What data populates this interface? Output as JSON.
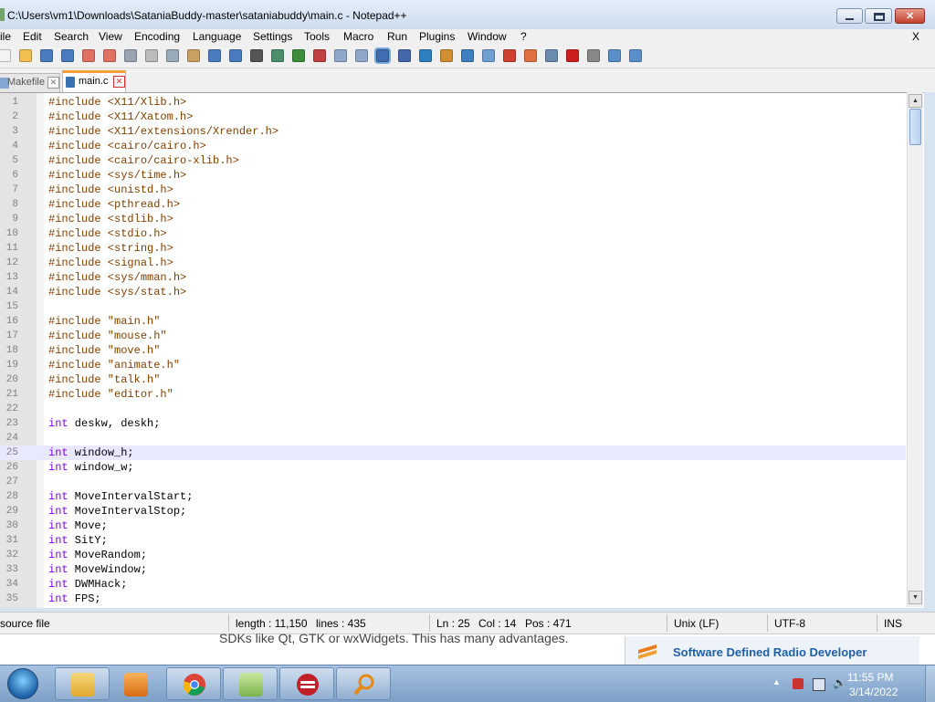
{
  "window": {
    "title": "C:\\Users\\vm1\\Downloads\\SataniaBuddy-master\\sataniabuddy\\main.c - Notepad++"
  },
  "menu": [
    {
      "label": "ile"
    },
    {
      "label": "Edit"
    },
    {
      "label": "Search"
    },
    {
      "label": "View"
    },
    {
      "label": "Encoding"
    },
    {
      "label": "Language"
    },
    {
      "label": "Settings"
    },
    {
      "label": "Tools"
    },
    {
      "label": "Macro"
    },
    {
      "label": "Run"
    },
    {
      "label": "Plugins"
    },
    {
      "label": "Window"
    },
    {
      "label": "?"
    }
  ],
  "menu_close": "X",
  "toolbar_icons": [
    "new-file-icon",
    "open-file-icon",
    "save-icon",
    "save-all-icon",
    "close-icon",
    "close-all-icon",
    "print-icon",
    "cut-icon",
    "copy-icon",
    "paste-icon",
    "undo-icon",
    "redo-icon",
    "find-icon",
    "replace-icon",
    "zoom-in-icon",
    "zoom-out-icon",
    "sync-vertical-icon",
    "sync-horizontal-icon",
    "word-wrap-icon",
    "show-all-chars-icon",
    "indent-guide-icon",
    "udl-icon",
    "doc-map-icon",
    "function-list-icon",
    "folder-workspace-icon",
    "monitoring-icon",
    "record-macro-icon",
    "stop-macro-icon",
    "play-macro-icon",
    "run-macro-multiple-icon",
    "save-macro-icon"
  ],
  "tabs": [
    {
      "label": "Makefile",
      "active": false
    },
    {
      "label": "main.c",
      "active": true
    }
  ],
  "code_lines": [
    {
      "n": "1",
      "parts": [
        [
          "pp",
          "#include <X11/Xlib.h>"
        ]
      ]
    },
    {
      "n": "2",
      "parts": [
        [
          "pp",
          "#include <X11/Xatom.h>"
        ]
      ]
    },
    {
      "n": "3",
      "parts": [
        [
          "pp",
          "#include <X11/extensions/Xrender.h>"
        ]
      ]
    },
    {
      "n": "4",
      "parts": [
        [
          "pp",
          "#include <cairo/cairo.h>"
        ]
      ]
    },
    {
      "n": "5",
      "parts": [
        [
          "pp",
          "#include <cairo/cairo-xlib.h>"
        ]
      ]
    },
    {
      "n": "6",
      "parts": [
        [
          "pp",
          "#include <sys/time.h>"
        ]
      ]
    },
    {
      "n": "7",
      "parts": [
        [
          "pp",
          "#include <unistd.h>"
        ]
      ]
    },
    {
      "n": "8",
      "parts": [
        [
          "pp",
          "#include <pthread.h>"
        ]
      ]
    },
    {
      "n": "9",
      "parts": [
        [
          "pp",
          "#include <stdlib.h>"
        ]
      ]
    },
    {
      "n": "10",
      "parts": [
        [
          "pp",
          "#include <stdio.h>"
        ]
      ]
    },
    {
      "n": "11",
      "parts": [
        [
          "pp",
          "#include <string.h>"
        ]
      ]
    },
    {
      "n": "12",
      "parts": [
        [
          "pp",
          "#include <signal.h>"
        ]
      ]
    },
    {
      "n": "13",
      "parts": [
        [
          "pp",
          "#include <sys/mman.h>"
        ]
      ]
    },
    {
      "n": "14",
      "parts": [
        [
          "pp",
          "#include <sys/stat.h>"
        ]
      ]
    },
    {
      "n": "15",
      "parts": []
    },
    {
      "n": "16",
      "parts": [
        [
          "pp",
          "#include \"main.h\""
        ]
      ]
    },
    {
      "n": "17",
      "parts": [
        [
          "pp",
          "#include \"mouse.h\""
        ]
      ]
    },
    {
      "n": "18",
      "parts": [
        [
          "pp",
          "#include \"move.h\""
        ]
      ]
    },
    {
      "n": "19",
      "parts": [
        [
          "pp",
          "#include \"animate.h\""
        ]
      ]
    },
    {
      "n": "20",
      "parts": [
        [
          "pp",
          "#include \"talk.h\""
        ]
      ]
    },
    {
      "n": "21",
      "parts": [
        [
          "pp",
          "#include \"editor.h\""
        ]
      ]
    },
    {
      "n": "22",
      "parts": []
    },
    {
      "n": "23",
      "parts": [
        [
          "kw",
          "int"
        ],
        [
          "plain",
          " deskw, deskh;"
        ]
      ]
    },
    {
      "n": "24",
      "parts": []
    },
    {
      "n": "25",
      "parts": [
        [
          "kw",
          "int"
        ],
        [
          "plain",
          " window_h;"
        ]
      ],
      "current": true
    },
    {
      "n": "26",
      "parts": [
        [
          "kw",
          "int"
        ],
        [
          "plain",
          " window_w;"
        ]
      ]
    },
    {
      "n": "27",
      "parts": []
    },
    {
      "n": "28",
      "parts": [
        [
          "kw",
          "int"
        ],
        [
          "plain",
          " MoveIntervalStart;"
        ]
      ]
    },
    {
      "n": "29",
      "parts": [
        [
          "kw",
          "int"
        ],
        [
          "plain",
          " MoveIntervalStop;"
        ]
      ]
    },
    {
      "n": "30",
      "parts": [
        [
          "kw",
          "int"
        ],
        [
          "plain",
          " Move;"
        ]
      ]
    },
    {
      "n": "31",
      "parts": [
        [
          "kw",
          "int"
        ],
        [
          "plain",
          " SitY;"
        ]
      ]
    },
    {
      "n": "32",
      "parts": [
        [
          "kw",
          "int"
        ],
        [
          "plain",
          " MoveRandom;"
        ]
      ]
    },
    {
      "n": "33",
      "parts": [
        [
          "kw",
          "int"
        ],
        [
          "plain",
          " MoveWindow;"
        ]
      ]
    },
    {
      "n": "34",
      "parts": [
        [
          "kw",
          "int"
        ],
        [
          "plain",
          " DWMHack;"
        ]
      ]
    },
    {
      "n": "35",
      "parts": [
        [
          "kw",
          "int"
        ],
        [
          "plain",
          " FPS;"
        ]
      ]
    }
  ],
  "status": {
    "file_type": "source file",
    "length": "length : 11,150",
    "lines": "lines : 435",
    "ln": "Ln : 25",
    "col": "Col : 14",
    "pos": "Pos : 471",
    "eol": "Unix (LF)",
    "encoding": "UTF-8",
    "mode": "INS"
  },
  "background_page": {
    "text_fragment": "SDKs like Qt, GTK or wxWidgets. This has many advantages.",
    "card_title": "Software Defined Radio Developer"
  },
  "taskbar": {
    "apps": [
      "file-explorer-icon",
      "media-player-icon",
      "chrome-icon",
      "notepad-plus-plus-icon",
      "dev-cpp-icon",
      "search-magnifier-icon"
    ],
    "time": "11:55 PM",
    "date": "3/14/2022"
  },
  "colors": {
    "preprocessor": "#804000",
    "keyword": "#8000ff",
    "current_line": "#e8e8ff",
    "tab_accent": "#f8a03a"
  }
}
